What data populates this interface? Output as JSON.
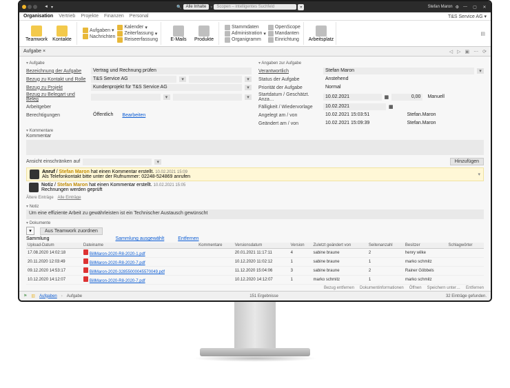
{
  "titlebar": {
    "search_scope": "Alle Inhalte",
    "search_placeholder": "Scopen – intelligentes Suchfeld",
    "user": "Stefan Maron"
  },
  "ribbon_tabs": {
    "items": [
      "Organisation",
      "Vertrieb",
      "Projekte",
      "Finanzen",
      "Personal"
    ],
    "context": "T&S Service AG"
  },
  "ribbon": {
    "teamwork": "Teamwork",
    "kontakte": "Kontakte",
    "aufgaben": "Aufgaben",
    "nachrichten": "Nachrichten",
    "kalender": "Kalender",
    "zeiterfassung": "Zeiterfassung",
    "reiseerfassung": "Reiseerfassung",
    "emails": "E-Mails",
    "produkte": "Produkte",
    "stammdaten": "Stammdaten",
    "administration": "Administration",
    "organigramm": "Organigramm",
    "openscope": "OpenScope",
    "mandanten": "Mandanten",
    "einrichtung": "Einrichtung",
    "arbeitsplatz": "Arbeitsplatz"
  },
  "subtab": {
    "label": "Aufgabe"
  },
  "form": {
    "section_left": "Aufgabe",
    "section_right": "Angaben zur Aufgabe",
    "bezeichnung_lbl": "Bezeichnung der Aufgabe",
    "bezeichnung": "Vertrag und Rechnung prüfen",
    "kontakt_lbl": "Bezug zu Kontakt und Rolle",
    "kontakt": "T&S Service AG",
    "projekt_lbl": "Bezug zu Projekt",
    "projekt": "Kundenprojekt für T&S Service AG",
    "belegart_lbl": "Bezug zu Belegart und Beleg",
    "arbeitgeber_lbl": "Arbeitgeber",
    "berecht_lbl": "Berechtigungen",
    "berecht_val": "Öffentlich",
    "bearbeiten": "Bearbeiten",
    "verantwortlich_lbl": "Verantwortlich",
    "verantwortlich": "Stefan Maron",
    "status_lbl": "Status der Aufgabe",
    "status": "Anstehend",
    "prio_lbl": "Priorität der Aufgabe",
    "prio": "Normal",
    "startdatum_lbl": "Startdatum / Geschätzt. Anza…",
    "startdatum": "10.02.2021",
    "aufwand": "0,00",
    "manuell": "Manuell",
    "faellig_lbl": "Fälligkeit / Wiedervorlage",
    "faellig": "10.02.2021",
    "angelegt_lbl": "Angelegt am / von",
    "angelegt_am": "10.02.2021 15:03:51",
    "angelegt_von": "Stefan.Maron",
    "geaendert_lbl": "Geändert am / von",
    "geaendert_am": "10.02.2021 15:09:39",
    "geaendert_von": "Stefan.Maron"
  },
  "kommentare": {
    "title": "Kommentare",
    "kommentar_lbl": "Kommentar",
    "filter_lbl": "Ansicht einschränken auf",
    "hinzufuegen": "Hinzufügen",
    "entry1_type": "Anruf",
    "entry1_user": "Stefan Maron",
    "entry1_suffix": "hat einen Kommentar erstellt.",
    "entry1_time": "10.02.2021 15:09",
    "entry1_body": "Als Telefonkontakt bitte unter der Rufnummer: 02248-524869 anrufen",
    "entry2_type": "Notiz",
    "entry2_user": "Stefan Maron",
    "entry2_suffix": "hat einen Kommentar erstellt.",
    "entry2_time": "10.02.2021 15:05",
    "entry2_body": "Rechnungen werden geprüft",
    "altere": "Ältere Einträge",
    "alle": "Alle Einträge"
  },
  "notiz": {
    "title": "Notiz",
    "body": "Um eine effiziente Arbeit zu gewährleisten ist ein Technischer Austausch gewünscht"
  },
  "dokumente": {
    "title": "Dokumente",
    "sammlung": "Sammlung",
    "aus_teamwork": "Aus Teamwork zuordnen",
    "sammlung_tab": "Sammlung ausgewählt",
    "entfernen": "Entfernen",
    "cols": {
      "upload": "Upload-Datum",
      "dateiname": "Dateiname",
      "kommentare": "Kommentare",
      "versionsdatum": "Versionsdatum",
      "version": "Version",
      "zuletzt": "Zuletzt geändert von",
      "seiten": "Seitenanzahl",
      "besitzer": "Besitzer",
      "schlag": "Schlagwörter"
    },
    "rows": [
      {
        "upload": "17.08.2020 14:02:18",
        "file": "BillMaron-2020-R8-2020-1.pdf",
        "vd": "20.01.2021 11:17:11",
        "ver": "4",
        "zg": "sabine braune",
        "s": "2",
        "own": "henry wilke"
      },
      {
        "upload": "20.11.2020 12:03:49",
        "file": "BillMaron-2020-R8-2020-7.pdf",
        "vd": "10.12.2020 11:02:12",
        "ver": "1",
        "zg": "sabine braune",
        "s": "1",
        "own": "marko schmitz"
      },
      {
        "upload": "09.12.2020 14:53:17",
        "file": "BillMaron-2020-32855000045570049.pdf",
        "vd": "11.12.2020 15:04:06",
        "ver": "3",
        "zg": "sabine braune",
        "s": "2",
        "own": "Rainer Göbbels"
      },
      {
        "upload": "10.12.2020 14:12:07",
        "file": "BillMaron-2020-R8-2020-7.pdf",
        "vd": "10.12.2020 14:12:07",
        "ver": "1",
        "zg": "marko schmitz",
        "s": "1",
        "own": "marko schmitz"
      }
    ],
    "footer_actions": [
      "Bezug entfernen",
      "Dokumentinformationen",
      "Öffnen",
      "Speichern unter…",
      "Entfernen"
    ]
  },
  "statusbar": {
    "crumb1": "Aufgaben",
    "crumb2": "Aufgabe",
    "results": "151 Ergebnisse",
    "count": "32 Einträge gefunden."
  }
}
